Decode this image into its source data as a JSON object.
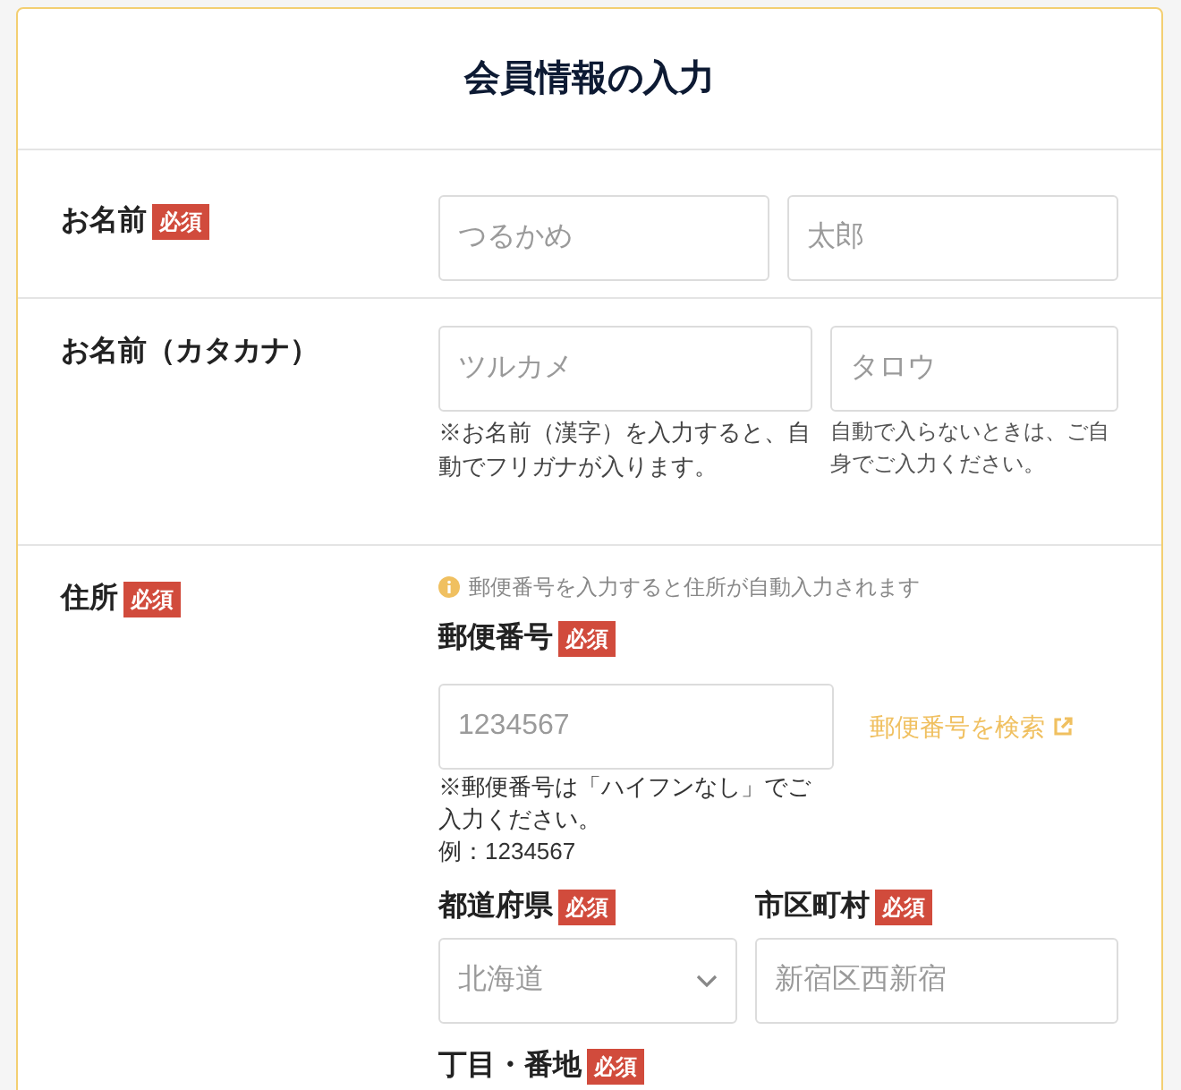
{
  "title": "会員情報の入力",
  "name_row": {
    "label": "お名前",
    "badge": "必須",
    "fields": [
      {
        "placeholder": "つるかめ"
      },
      {
        "placeholder": "太郎"
      }
    ]
  },
  "kana_row": {
    "label": "お名前（カタカナ）",
    "fields": [
      {
        "placeholder": "ツルカメ",
        "note": "※お名前（漢字）を入力すると、自動でフリガナが入ります。"
      },
      {
        "placeholder": "タロウ",
        "note": "自動で入らないときは、ご自身でご入力ください。"
      }
    ]
  },
  "address_row": {
    "label": "住所",
    "badge": "必須",
    "info": "郵便番号を入力すると住所が自動入力されます",
    "postal": {
      "label": "郵便番号",
      "badge": "必須",
      "placeholder": "1234567",
      "link": "郵便番号を検索",
      "notes": [
        "※郵便番号は「ハイフンなし」でご入力ください。",
        "例：1234567"
      ]
    },
    "prefecture": {
      "label": "都道府県",
      "badge": "必須",
      "value": "北海道"
    },
    "city": {
      "label": "市区町村",
      "badge": "必須",
      "placeholder": "新宿区西新宿"
    },
    "street": {
      "label": "丁目・番地",
      "badge": "必須"
    }
  }
}
